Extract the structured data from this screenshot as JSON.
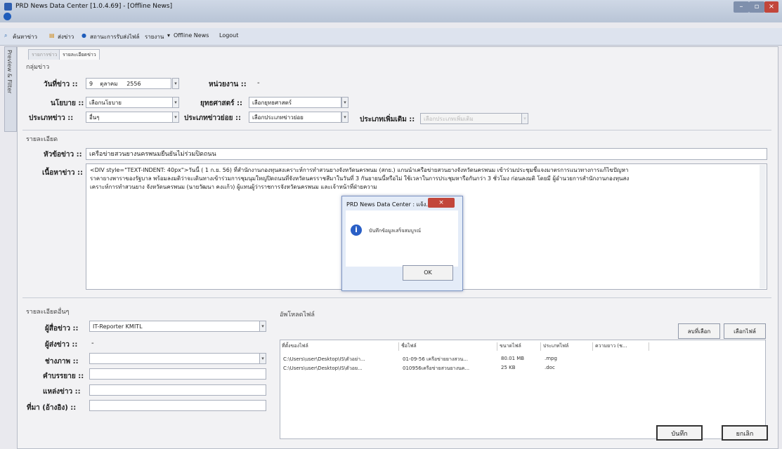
{
  "window": {
    "title": "PRD News Data Center [1.0.4.69] - [Offline News]"
  },
  "toolbar": {
    "search": "ค้นหาข่าว",
    "send": "ส่งข่าว",
    "status": "สถานะการรับส่งไฟล์",
    "report": "รายงาน",
    "offline": "Offline News",
    "logout": "Logout"
  },
  "sidebar": {
    "label": "Preview & Filter"
  },
  "tabs": [
    {
      "label": "รายการข่าว"
    },
    {
      "label": "รายละเอียดข่าว"
    }
  ],
  "group": {
    "title": "กลุ่มข่าว",
    "date_label": "วันที่ข่าว ::",
    "day": "9",
    "month": "ตุลาคม",
    "year": "2556",
    "unit_label": "หน่วยงาน ::",
    "unit_value": "-",
    "policy_label": "นโยบาย ::",
    "policy_value": "เลือกนโยบาย",
    "strategy_label": "ยุทธศาสตร์ ::",
    "strategy_value": "เลือกยุทธศาสตร์",
    "type_label": "ประเภทข่าว ::",
    "type_value": "อื่นๆ",
    "subtype_label": "ประเภทข่าวย่อย ::",
    "subtype_value": "เลือกประเภทข่าวย่อย",
    "extra_label": "ประเภทเพิ่มเติม ::",
    "extra_value": "เลือกประเภทเพิ่มเติม"
  },
  "detail": {
    "title": "รายละเอียด",
    "headline_label": "หัวข้อข่าว ::",
    "headline_value": "เครือข่ายสวนยางนครพนมยืนยันไม่ร่วมปิดถนน",
    "content_label": "เนื้อหาข่าว ::",
    "content_line1": "<DIV style=\"TEXT-INDENT: 40px\">วันนี้ ( 1 ก.ย. 56) ที่สำนักงานกองทุนสงเคราะห์การทำสวนยางจังหวัดนครพนม (สกย.) แกนนำเครือข่ายสวนยางจังหวัดนครพนม เข้าร่วมประชุมชี้แจงมาตรการแนวทางการแก้ไขปัญหา",
    "content_line2": "ราคายางพาราของรัฐบาล พร้อมลงมติว่าจะเดินทางเข้าร่วมการชุมนุมใหญ่ปิดถนนที่จังหวัดนครราชสีมาในวันที่ 3 กันยายนนี้หรือไม่ ใช้เวลาในการประชุมหารือกันกว่า 3 ชั่วโมง ก่อนลงมติ โดยมี ผู้อำนวยการสำนักงานกองทุนสง",
    "content_line3": "เคราะห์การทำสวนยาง จังหวัดนครพนม (นายวัฒนา คงแก้ว) ผู้แทนผู้ว่าราชการจังหวัดนครพนม และเจ้าหน้าที่ฝ่ายความ"
  },
  "dialog": {
    "title": "PRD News Data Center : แจ้ง..",
    "message": "บันทึกข้อมูลเสร็จสมบูรณ์",
    "ok": "OK"
  },
  "other": {
    "title": "รายละเอียดอื่นๆ",
    "reporter_label": "ผู้สื่อข่าว ::",
    "reporter_value": "IT-Reporter KMITL",
    "sender_label": "ผู้ส่งข่าว ::",
    "sender_value": "-",
    "photographer_label": "ช่างภาพ ::",
    "caption_label": "คำบรรยาย ::",
    "source_label": "แหล่งข่าว ::",
    "reference_label": "ที่มา (อ้างอิง) ::"
  },
  "upload": {
    "title": "อัพโหลดไฟล์",
    "delete": "ลบที่เลือก",
    "choose": "เลือกไฟล์",
    "columns": [
      "ที่ตั้งของไฟล์",
      "ชื่อไฟล์",
      "ขนาดไฟล์",
      "ประเภทไฟล์",
      "ความยาว (ช..."
    ],
    "rows": [
      [
        "C:\\Users\\user\\Desktop\\IS\\ตัวอย่า...",
        "01-09-56 เครือข่ายยางสวน...",
        "80.01 MB",
        ".mpg"
      ],
      [
        "C:\\Users\\user\\Desktop\\IS\\ตัวอย...",
        "010956เครือข่ายสวนยางนค...",
        "25 KB",
        ".doc"
      ]
    ]
  },
  "actions": {
    "save": "บันทึก",
    "cancel": "ยกเลิก"
  }
}
